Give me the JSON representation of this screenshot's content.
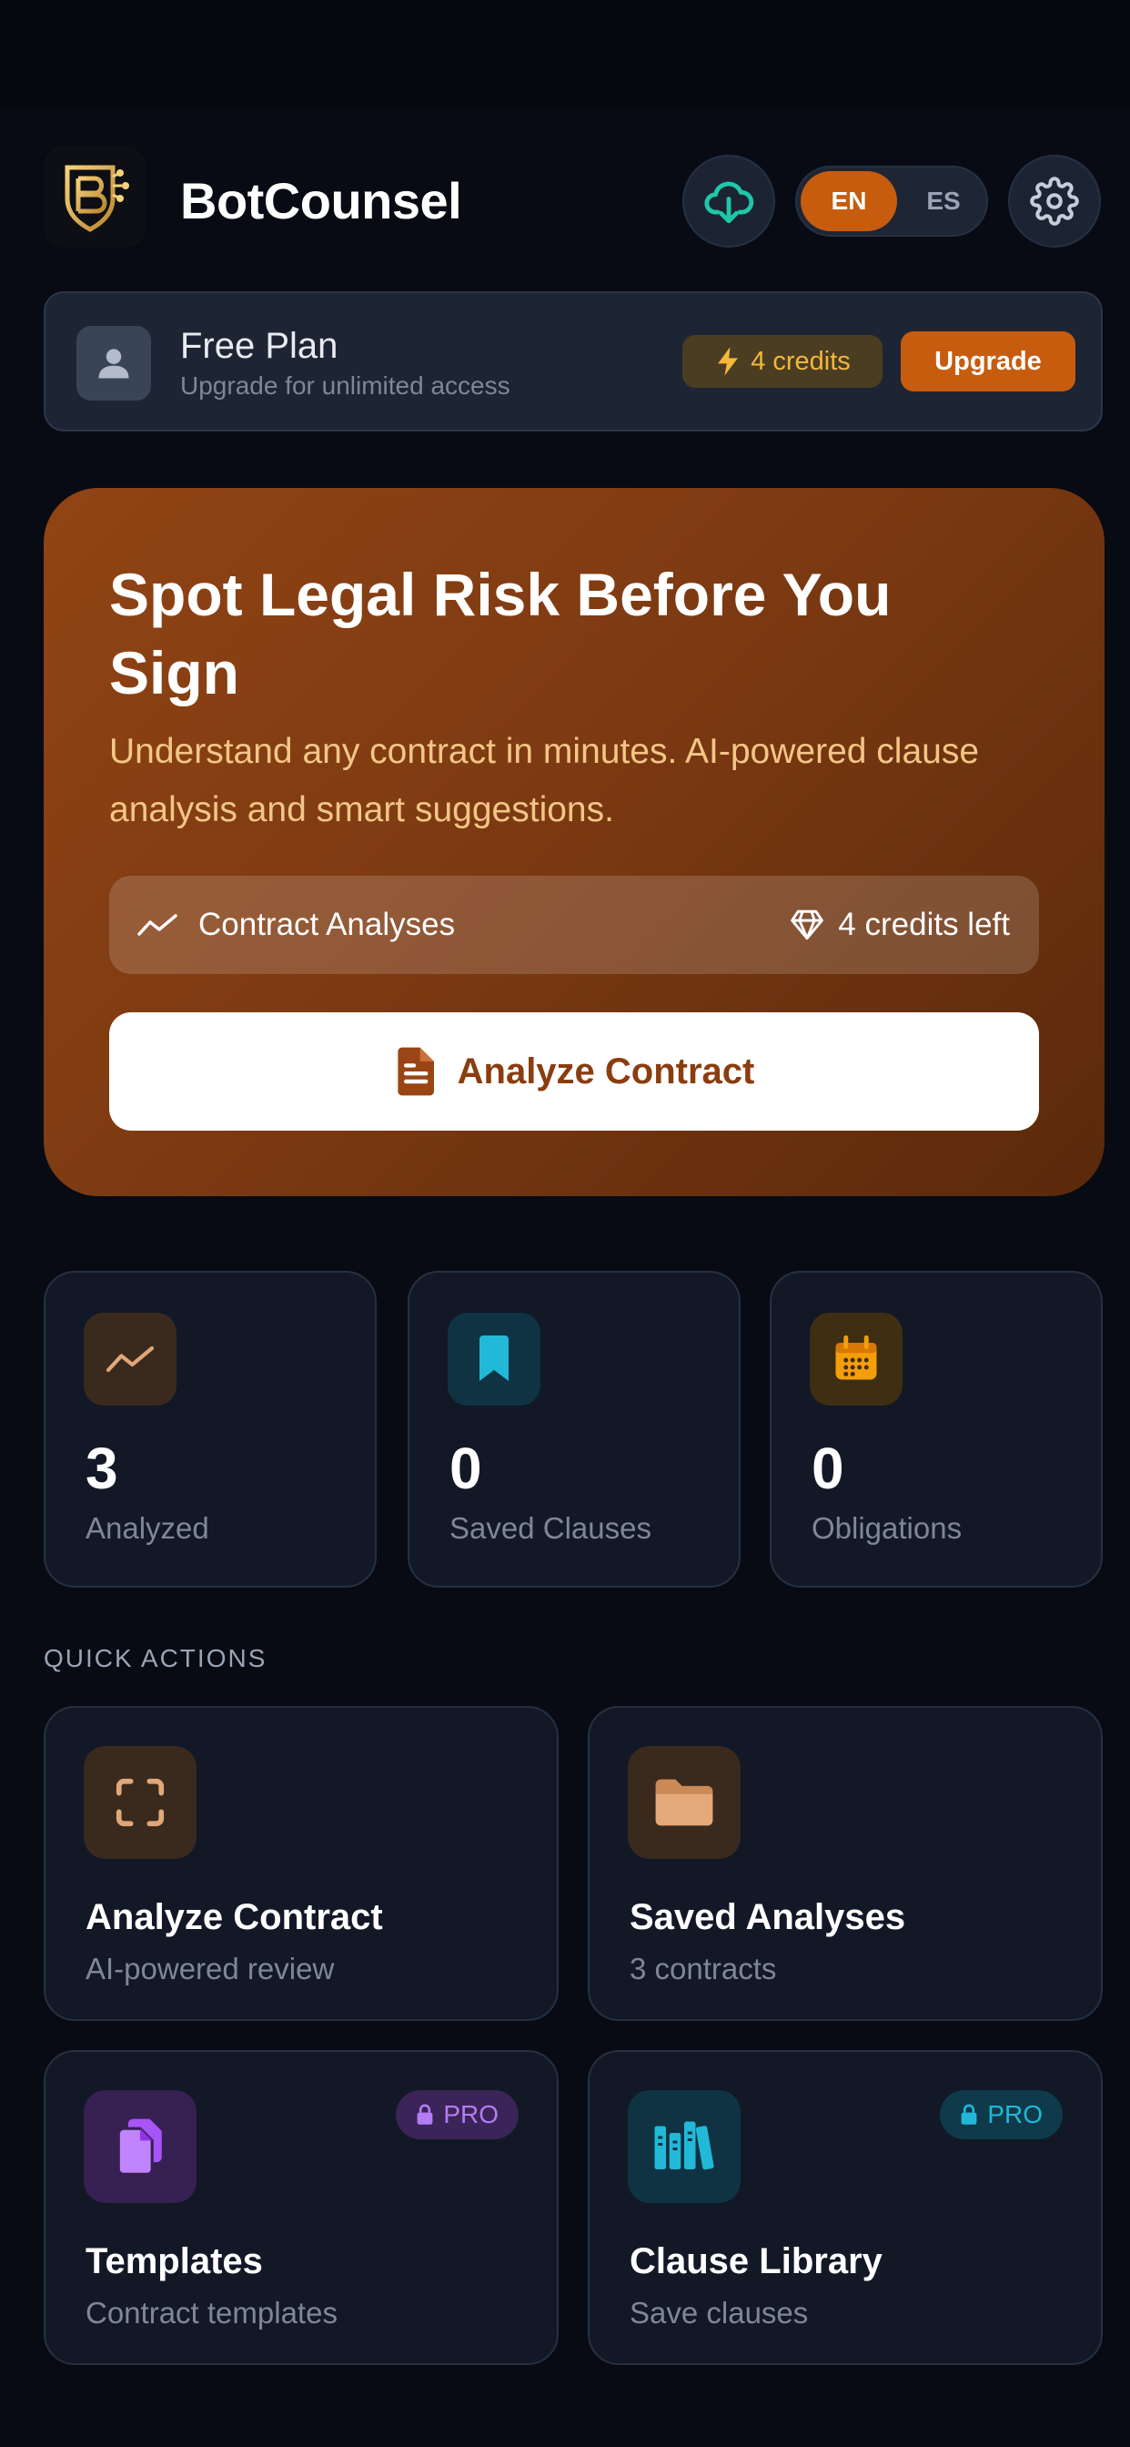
{
  "header": {
    "app_title": "BotCounsel",
    "lang": {
      "active": "EN",
      "inactive": "ES"
    }
  },
  "plan": {
    "title": "Free Plan",
    "subtitle": "Upgrade for unlimited access",
    "credits": "4 credits",
    "upgrade_label": "Upgrade"
  },
  "hero": {
    "title": "Spot Legal Risk Before You Sign",
    "description": "Understand any contract in minutes. AI-powered clause analysis and smart suggestions.",
    "stats_label": "Contract Analyses",
    "credits_left": "4 credits left",
    "cta_label": "Analyze Contract"
  },
  "stats": [
    {
      "value": "3",
      "label": "Analyzed",
      "icon": "trend-icon"
    },
    {
      "value": "0",
      "label": "Saved Clauses",
      "icon": "bookmark-icon"
    },
    {
      "value": "0",
      "label": "Obligations",
      "icon": "calendar-icon"
    }
  ],
  "quick_actions": {
    "section_label": "QUICK ACTIONS",
    "items": [
      {
        "title": "Analyze Contract",
        "subtitle": "AI-powered review",
        "icon": "scan-icon"
      },
      {
        "title": "Saved Analyses",
        "subtitle": "3 contracts",
        "icon": "folder-icon"
      },
      {
        "title": "Templates",
        "subtitle": "Contract templates",
        "icon": "copy-document-icon",
        "badge": "PRO"
      },
      {
        "title": "Clause Library",
        "subtitle": "Save clauses",
        "icon": "library-icon",
        "badge": "PRO"
      }
    ]
  },
  "colors": {
    "background": "#080b13",
    "accent": "#c75c0f",
    "card": "#121826",
    "credits_text": "#f3b73a",
    "pro_purple": "#a855f7",
    "pro_cyan": "#22b8d8"
  }
}
